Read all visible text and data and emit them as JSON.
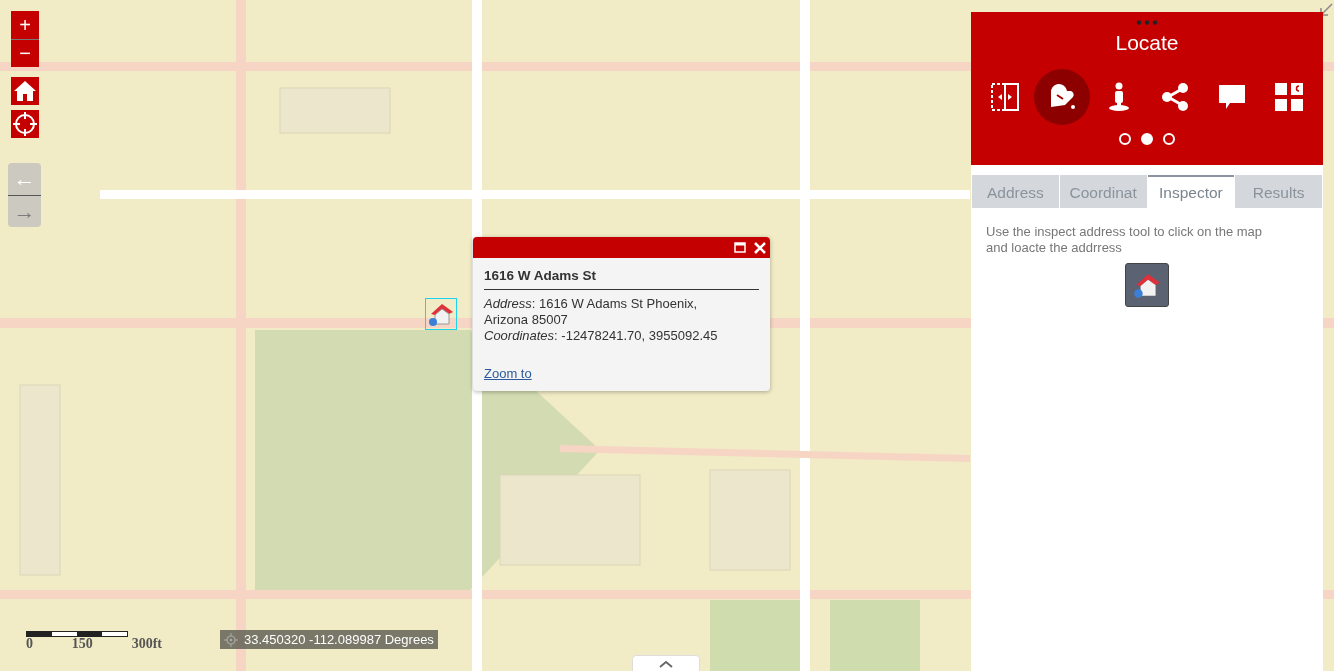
{
  "zoom_controls": {
    "zoom_in": "+",
    "zoom_out": "−"
  },
  "nav_arrows": [
    {
      "label": "←",
      "disabled": false
    },
    {
      "label": "→",
      "disabled": true
    }
  ],
  "popup": {
    "title": "1616 W Adams St",
    "lines": [
      "*Address*: 1616 W Adams St Phoenix,",
      "Arizona 85007",
      "*Coordinates*: -12478241.70, 3955092.45"
    ],
    "link": "Zoom to"
  },
  "panel": {
    "title": "Locate",
    "tools": [
      {
        "kind": "swipe",
        "selected": false
      },
      {
        "kind": "mailbox",
        "selected": true
      },
      {
        "kind": "figure",
        "selected": false
      },
      {
        "kind": "share",
        "selected": false
      },
      {
        "kind": "comment",
        "selected": false
      },
      {
        "kind": "grid",
        "selected": false
      }
    ],
    "pages": [
      {
        "selected": false
      },
      {
        "selected": true
      },
      {
        "selected": false
      }
    ],
    "tabs": [
      {
        "label": "Address",
        "selected": false
      },
      {
        "label": "Coordinat",
        "selected": false
      },
      {
        "label": "Inspector",
        "selected": true
      },
      {
        "label": "Results",
        "selected": false
      }
    ],
    "description": "Use the inspect address tool to click on the map and loacte the addrress"
  },
  "scale_bar": {
    "labels": [
      "0",
      "150",
      "300ft"
    ]
  },
  "coordinates": "33.450320 -112.089987 Degrees"
}
